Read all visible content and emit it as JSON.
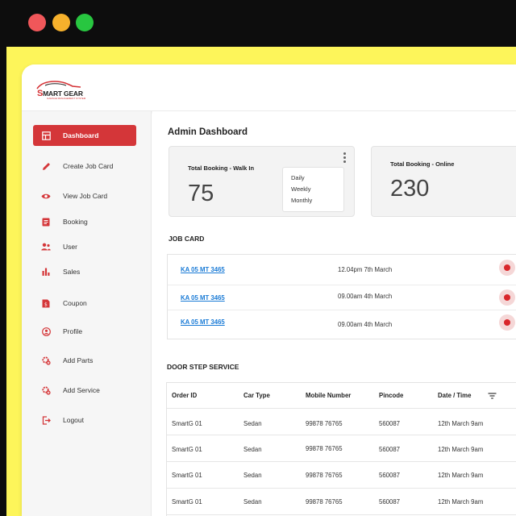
{
  "window": {
    "controls": [
      "close",
      "minimize",
      "maximize"
    ],
    "colors": {
      "close": "#f0575a",
      "minimize": "#f6b12c",
      "maximize": "#28c640"
    }
  },
  "logo": {
    "first_letter": "S",
    "name": "MART GEAR",
    "tagline": "GARAGE MANAGEMENT SYSTEM"
  },
  "sidebar": {
    "items": [
      {
        "label": "Dashboard",
        "icon": "dashboard-icon",
        "active": true
      },
      {
        "label": "Create Job Card",
        "icon": "pencil-icon"
      },
      {
        "label": "View Job Card",
        "icon": "eye-icon"
      },
      {
        "label": "Booking",
        "icon": "document-icon"
      },
      {
        "label": "User",
        "icon": "users-icon"
      },
      {
        "label": "Sales",
        "icon": "bar-chart-icon"
      },
      {
        "label": "Coupon",
        "icon": "coupon-icon"
      },
      {
        "label": "Profile",
        "icon": "profile-icon"
      },
      {
        "label": "Add Parts",
        "icon": "add-parts-icon"
      },
      {
        "label": "Add Service",
        "icon": "add-service-icon"
      },
      {
        "label": "Logout",
        "icon": "logout-icon"
      }
    ],
    "accent": "#d43639"
  },
  "main": {
    "title": "Admin Dashboard",
    "cards": [
      {
        "title": "Total Booking - Walk In",
        "value": "75",
        "period_options": [
          "Daily",
          "Weekly",
          "Monthly"
        ]
      },
      {
        "title": "Total Booking - Online",
        "value": "230"
      }
    ],
    "job_card": {
      "title": "JOB CARD",
      "rows": [
        {
          "vehicle": "KA 05 MT 3465",
          "time": "12.04pm 7th March"
        },
        {
          "vehicle": "KA 05 MT 3465",
          "time": "09.00am 4th March"
        },
        {
          "vehicle": "KA 05 MT 3465",
          "time": "09.00am 4th March"
        }
      ],
      "status_color": "#d9262b"
    },
    "door_step": {
      "title": "DOOR STEP SERVICE",
      "columns": [
        "Order ID",
        "Car Type",
        "Mobile Number",
        "Pincode",
        "Date  / Time"
      ],
      "rows": [
        [
          "SmartG 01",
          "Sedan",
          "99878 76765",
          "560087",
          "12th March 9am"
        ],
        [
          "SmartG 01",
          "Sedan",
          "99878 76765",
          "560087",
          "12th March 9am"
        ],
        [
          "SmartG 01",
          "Sedan",
          "99878 76765",
          "560087",
          "12th March 9am"
        ],
        [
          "SmartG 01",
          "Sedan",
          "99878 76765",
          "560087",
          "12th March 9am"
        ]
      ]
    }
  }
}
